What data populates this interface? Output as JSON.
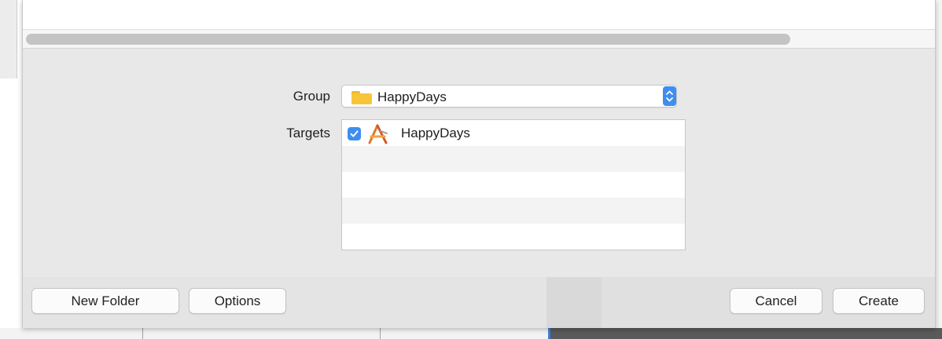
{
  "dialog": {
    "group": {
      "label": "Group",
      "selected_value": "HappyDays",
      "icon": "folder-icon"
    },
    "targets": {
      "label": "Targets",
      "items": [
        {
          "name": "HappyDays",
          "checked": true,
          "icon": "xcode-app-icon"
        }
      ]
    },
    "footer": {
      "new_folder_label": "New Folder",
      "options_label": "Options",
      "cancel_label": "Cancel",
      "create_label": "Create"
    }
  },
  "colors": {
    "accent": "#3d8ef0",
    "folder": "#f7c53a",
    "sheet_background": "#e8e8e8"
  }
}
